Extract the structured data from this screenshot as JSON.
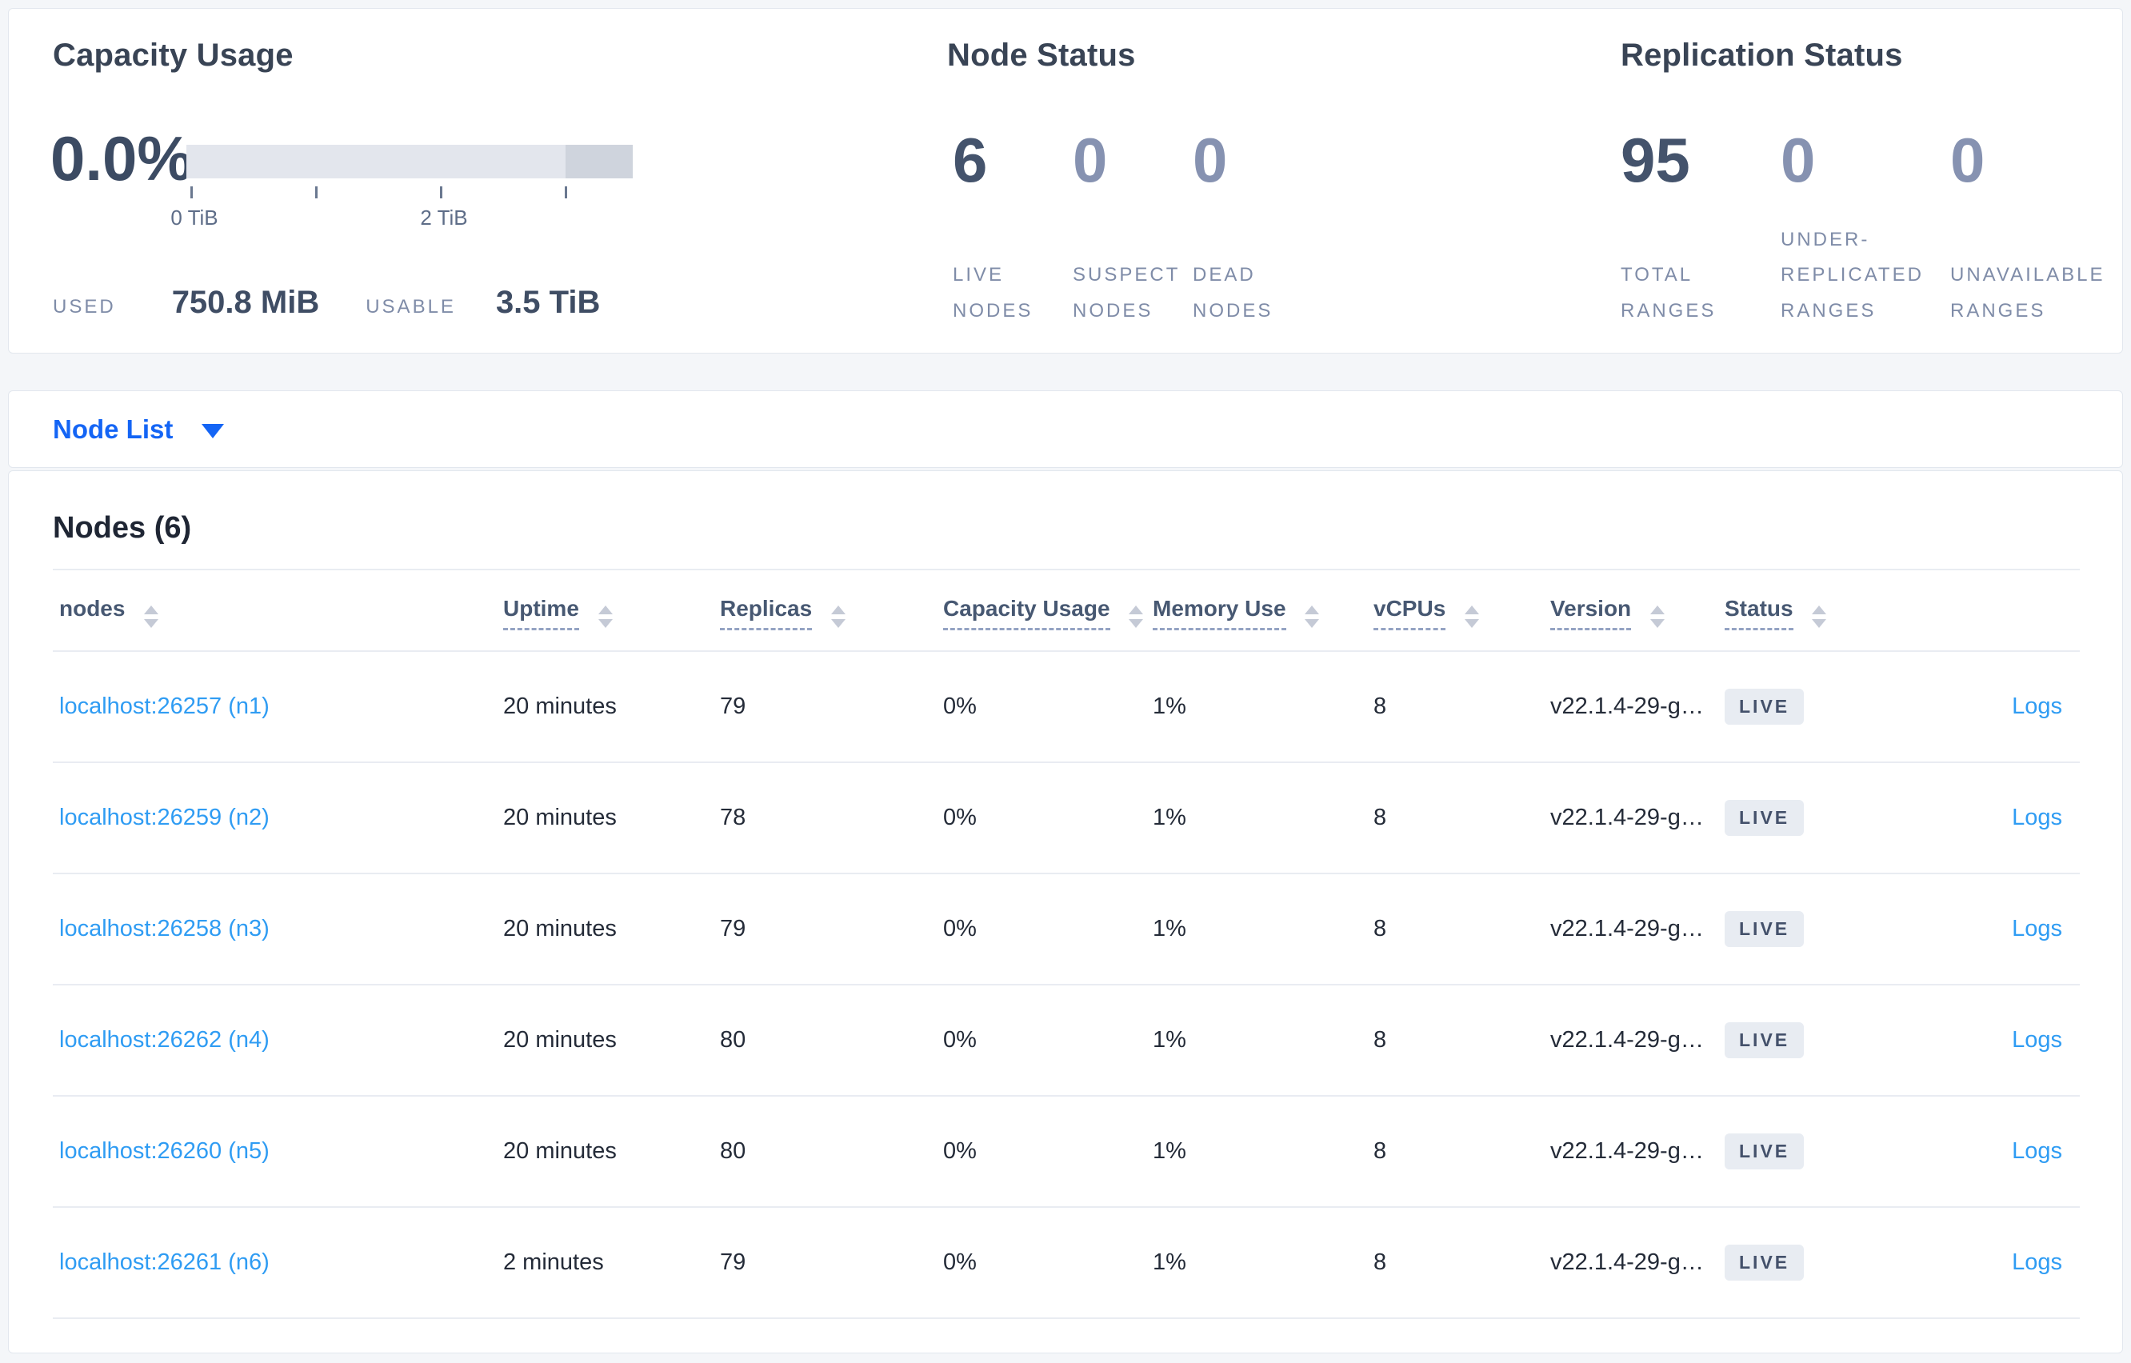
{
  "colors": {
    "accent_blue": "#1465f5",
    "link_blue": "#2f9cf3",
    "text_dark": "#394455",
    "muted_label": "#7f8ca8",
    "badge_bg": "#e8ecf2",
    "bar_light": "#e3e6ed",
    "bar_dark": "#cfd4dd"
  },
  "summary": {
    "capacity": {
      "title": "Capacity Usage",
      "percent": "0.0%",
      "tick_labels": [
        "0 TiB",
        "2 TiB"
      ],
      "used_label": "USED",
      "used_value": "750.8 MiB",
      "usable_label": "USABLE",
      "usable_value": "3.5 TiB"
    },
    "node_status": {
      "title": "Node Status",
      "stats": [
        {
          "value": "6",
          "label": "LIVE NODES"
        },
        {
          "value": "0",
          "label": "SUSPECT NODES"
        },
        {
          "value": "0",
          "label": "DEAD NODES"
        }
      ]
    },
    "replication": {
      "title": "Replication Status",
      "stats": [
        {
          "value": "95",
          "label": "TOTAL RANGES"
        },
        {
          "value": "0",
          "label": "UNDER-REPLICATED RANGES"
        },
        {
          "value": "0",
          "label": "UNAVAILABLE RANGES"
        }
      ]
    }
  },
  "view_selector": {
    "label": "Node List"
  },
  "nodes_table": {
    "title": "Nodes (6)",
    "columns": [
      "nodes",
      "Uptime",
      "Replicas",
      "Capacity Usage",
      "Memory Use",
      "vCPUs",
      "Version",
      "Status"
    ],
    "rows": [
      {
        "node": "localhost:26257 (n1)",
        "uptime": "20 minutes",
        "replicas": "79",
        "capacity": "0%",
        "memory": "1%",
        "vcpus": "8",
        "version": "v22.1.4-29-g…",
        "status": "LIVE",
        "logs": "Logs"
      },
      {
        "node": "localhost:26259 (n2)",
        "uptime": "20 minutes",
        "replicas": "78",
        "capacity": "0%",
        "memory": "1%",
        "vcpus": "8",
        "version": "v22.1.4-29-g…",
        "status": "LIVE",
        "logs": "Logs"
      },
      {
        "node": "localhost:26258 (n3)",
        "uptime": "20 minutes",
        "replicas": "79",
        "capacity": "0%",
        "memory": "1%",
        "vcpus": "8",
        "version": "v22.1.4-29-g…",
        "status": "LIVE",
        "logs": "Logs"
      },
      {
        "node": "localhost:26262 (n4)",
        "uptime": "20 minutes",
        "replicas": "80",
        "capacity": "0%",
        "memory": "1%",
        "vcpus": "8",
        "version": "v22.1.4-29-g…",
        "status": "LIVE",
        "logs": "Logs"
      },
      {
        "node": "localhost:26260 (n5)",
        "uptime": "20 minutes",
        "replicas": "80",
        "capacity": "0%",
        "memory": "1%",
        "vcpus": "8",
        "version": "v22.1.4-29-g…",
        "status": "LIVE",
        "logs": "Logs"
      },
      {
        "node": "localhost:26261 (n6)",
        "uptime": "2 minutes",
        "replicas": "79",
        "capacity": "0%",
        "memory": "1%",
        "vcpus": "8",
        "version": "v22.1.4-29-g…",
        "status": "LIVE",
        "logs": "Logs"
      }
    ]
  }
}
